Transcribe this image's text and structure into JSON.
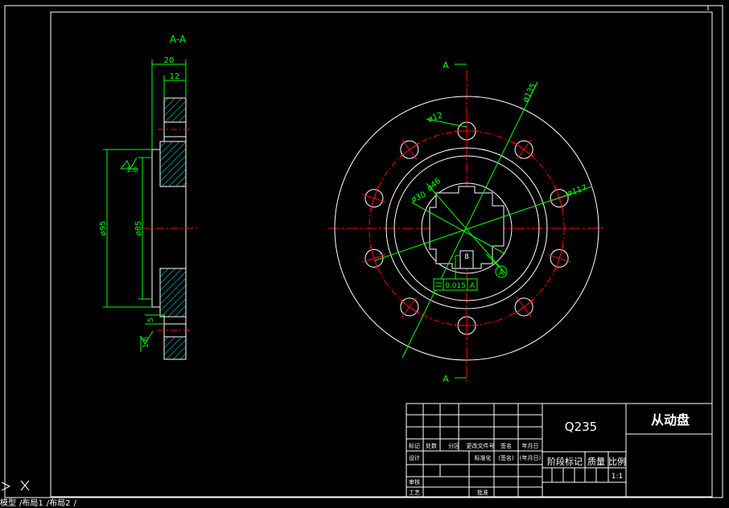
{
  "section_label": "A-A",
  "section_marker": "A",
  "datum_label": "A",
  "side_view_dims": {
    "width_total": "20",
    "width_hub": "12",
    "dia_95": "ø95",
    "dia_85": "ø85",
    "rough_1": "1.6",
    "rough_2": "1.6",
    "step": "5"
  },
  "front_view_dims": {
    "bolt_circle": "ø135",
    "hole": "ø12",
    "outer": "ø117",
    "hub_46": "ø46",
    "bore_30": "ø30",
    "key": "8",
    "tolerance_value": "0.015",
    "tolerance_datum": "A"
  },
  "title_block": {
    "material": "Q235",
    "part_name": "从动盘",
    "stage_mark": "阶段标记",
    "mass": "质量",
    "scale_label": "比例",
    "scale_value": "1:1",
    "headers": [
      "标记",
      "处数",
      "分区",
      "更改文件号",
      "签名",
      "年月日"
    ],
    "design": "设计",
    "standardize": "标准化",
    "sign": "(签名)",
    "date": "(年月日)",
    "review": "审核",
    "process": "工艺",
    "approve": "批准"
  },
  "tabs": [
    "模型",
    "布局1",
    "布局2"
  ],
  "colors": {
    "background": "#000000",
    "outline": "#ffffff",
    "dimension": "#00ff00",
    "centerline": "#ff0000",
    "section": "#00ffff"
  }
}
